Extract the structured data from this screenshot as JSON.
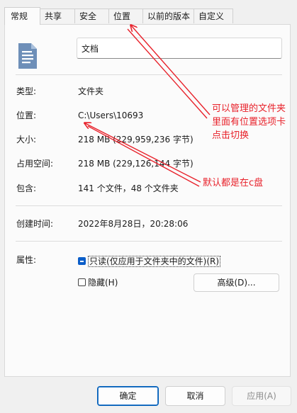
{
  "tabs": [
    {
      "label": "常规",
      "active": true
    },
    {
      "label": "共享",
      "active": false
    },
    {
      "label": "安全",
      "active": false
    },
    {
      "label": "位置",
      "active": false
    },
    {
      "label": "以前的版本",
      "active": false
    },
    {
      "label": "自定义",
      "active": false
    }
  ],
  "general": {
    "folder_icon": "document-folder-icon",
    "folder_name": "文档",
    "type_label": "类型:",
    "type_value": "文件夹",
    "location_label": "位置:",
    "location_value": "C:\\Users\\10693",
    "size_label": "大小:",
    "size_value": "218 MB (229,959,236 字节)",
    "disk_size_label": "占用空间:",
    "disk_size_value": "218 MB (229,126,144 字节)",
    "contains_label": "包含:",
    "contains_value": "141 个文件，48 个文件夹",
    "created_label": "创建时间:",
    "created_value": "2022年8月28日，20:28:06",
    "attributes_label": "属性:",
    "readonly_label": "只读(仅应用于文件夹中的文件)(R)",
    "readonly_state": "indeterminate",
    "hidden_label": "隐藏(H)",
    "hidden_checked": false,
    "advanced_button": "高级(D)..."
  },
  "footer": {
    "ok": "确定",
    "cancel": "取消",
    "apply": "应用(A)"
  },
  "annotations": {
    "note1_line1": "可以管理的文件夹",
    "note1_line2": "里面有位置选项卡",
    "note1_line3": "点击切换",
    "note2": "默认都是在c盘",
    "arrow_color": "#e8222b"
  }
}
